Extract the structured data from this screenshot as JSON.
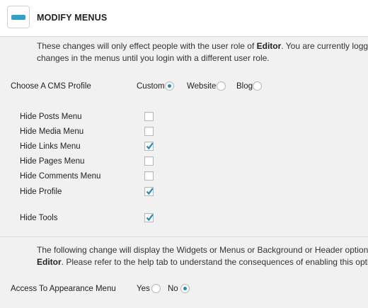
{
  "header": {
    "title": "MODIFY MENUS",
    "icon": "menu-bar-icon"
  },
  "intro": {
    "line1_pre": "These changes will only effect people with the user role of ",
    "line1_bold": "Editor",
    "line1_post": ". You are currently logged",
    "line2": "changes in the menus until you login with a different user role."
  },
  "cms_profile": {
    "label": "Choose A CMS Profile",
    "options": [
      {
        "label": "Custom",
        "selected": true
      },
      {
        "label": "Website",
        "selected": false
      },
      {
        "label": "Blog",
        "selected": false
      }
    ]
  },
  "menu_options": [
    {
      "label": "Hide Posts Menu",
      "checked": false
    },
    {
      "label": "Hide Media Menu",
      "checked": false
    },
    {
      "label": "Hide Links Menu",
      "checked": true
    },
    {
      "label": "Hide Pages Menu",
      "checked": false
    },
    {
      "label": "Hide Comments Menu",
      "checked": false
    },
    {
      "label": "Hide Profile",
      "checked": true
    },
    {
      "label": "Hide Tools",
      "checked": true
    }
  ],
  "appearance_note": {
    "line1": "The following change will display the Widgets or Menus or Background or Header options",
    "line2_bold": "Editor",
    "line2_post": ". Please refer to the help tab to understand the consequences of enabling this option"
  },
  "appearance": {
    "label": "Access To Appearance Menu",
    "options": [
      {
        "label": "Yes",
        "selected": false
      },
      {
        "label": "No",
        "selected": true
      }
    ]
  },
  "colors": {
    "accent": "#1e8cbe",
    "icon": "#2ea2cc",
    "background": "#f1f1f1"
  }
}
